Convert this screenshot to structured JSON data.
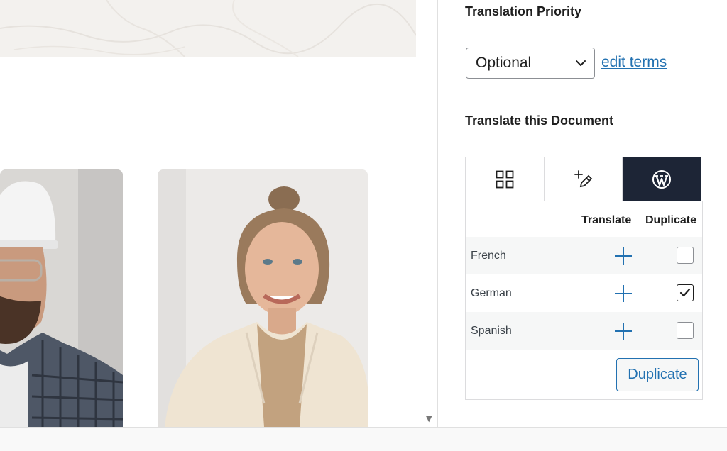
{
  "sidebar": {
    "priority_title": "Translation Priority",
    "priority_value": "Optional",
    "edit_terms_label": "edit terms",
    "translate_title": "Translate this Document",
    "tabs": [
      {
        "icon": "grid-icon",
        "active": false
      },
      {
        "icon": "pen-plus-icon",
        "active": false
      },
      {
        "icon": "wordpress-icon",
        "active": true
      }
    ],
    "table": {
      "col_translate": "Translate",
      "col_duplicate": "Duplicate",
      "rows": [
        {
          "language": "French",
          "duplicate_checked": false
        },
        {
          "language": "German",
          "duplicate_checked": true
        },
        {
          "language": "Spanish",
          "duplicate_checked": false
        }
      ],
      "duplicate_button": "Duplicate"
    }
  },
  "colors": {
    "accent": "#2271b1",
    "active_tab": "#1d2536"
  }
}
